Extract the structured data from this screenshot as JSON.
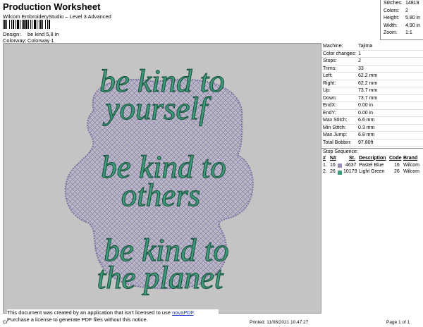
{
  "header": {
    "title": "Production Worksheet",
    "subtitle": "Wilcom EmbroideryStudio – Level 3 Advanced",
    "design_label": "Design:",
    "design_value": "be kind 5,8 in",
    "colorway_label": "Colorway:",
    "colorway_value": "Colorway 1"
  },
  "stats": [
    {
      "label": "Stitches:",
      "value": "14818"
    },
    {
      "label": "Colors:",
      "value": "2"
    },
    {
      "label": "Height:",
      "value": "5.80 in"
    },
    {
      "label": "Width:",
      "value": "4.90 in"
    },
    {
      "label": "Zoom:",
      "value": "1:1"
    }
  ],
  "machine": [
    {
      "label": "Machine:",
      "value": "Tajima"
    },
    {
      "label": "Color changes:",
      "value": "1"
    },
    {
      "label": "Stops:",
      "value": "2"
    },
    {
      "label": "Trims:",
      "value": "33"
    },
    {
      "label": "Left:",
      "value": "62.2 mm"
    },
    {
      "label": "Right:",
      "value": "62.2 mm"
    },
    {
      "label": "Up:",
      "value": "73.7 mm"
    },
    {
      "label": "Down:",
      "value": "73.7 mm"
    },
    {
      "label": "EndX:",
      "value": "0.00 in"
    },
    {
      "label": "EndY:",
      "value": "0.00 in"
    },
    {
      "label": "Max Stitch:",
      "value": "6.6 mm"
    },
    {
      "label": "Min Stitch:",
      "value": "0.3 mm"
    },
    {
      "label": "Max Jump:",
      "value": "6.8 mm"
    },
    {
      "label": "Total Bobbin:",
      "value": "97.80ft"
    }
  ],
  "stop_sequence": {
    "title": "Stop Sequence:",
    "headers": [
      "#",
      "N#",
      "St.",
      "Description",
      "Code",
      "Brand"
    ],
    "rows": [
      {
        "num": "1.",
        "n": "16",
        "st": "4637",
        "description": "Pastel Blue",
        "code": "16",
        "brand": "Wilcom",
        "color": "#9b8fb8"
      },
      {
        "num": "2.",
        "n": "26",
        "st": "10179",
        "description": "Light Green",
        "code": "26",
        "brand": "Wilcom",
        "color": "#3f9c7d"
      }
    ]
  },
  "design_text": [
    "be kind to",
    "yourself",
    "be kind to",
    "others",
    "be kind to",
    "the planet"
  ],
  "notice": {
    "line1": "This document was created by an application that isn't licensed to use ",
    "link": "novaPDF",
    "line1_end": ".",
    "line2": "Purchase a license to generate PDF files without this notice."
  },
  "footer": {
    "left": "Cr",
    "printed": "Printed: 11/08/2021 10.47.27",
    "page": "Page 1 of 1"
  },
  "colors": {
    "fill_stitch": "#9b8fb8",
    "text_stitch": "#3f9c7d",
    "canvas_bg": "#c4c4c4"
  }
}
